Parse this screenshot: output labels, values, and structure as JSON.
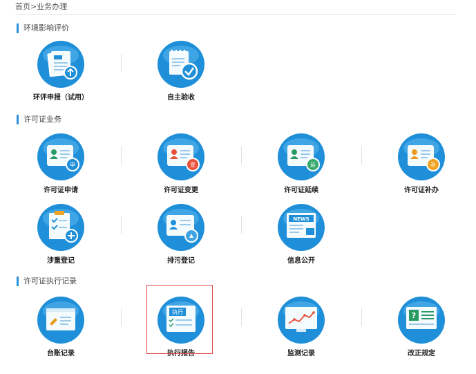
{
  "breadcrumb": "首页>业务办理",
  "accent": "#1e8fd8",
  "sections": [
    {
      "title": "环境影响评价"
    },
    {
      "title": "许可证业务"
    },
    {
      "title": "许可证执行记录"
    }
  ],
  "tiles": [
    {
      "label": "环评申报（试用）",
      "icon": "report-upload-icon"
    },
    {
      "label": "自主验收",
      "icon": "acceptance-check-icon"
    },
    {
      "label": "许可证申请",
      "icon": "license-apply-icon",
      "badge": "申"
    },
    {
      "label": "许可证变更",
      "icon": "license-change-icon",
      "badge": "变"
    },
    {
      "label": "许可证延续",
      "icon": "license-extend-icon",
      "badge": "延"
    },
    {
      "label": "许可证补办",
      "icon": "license-reissue-icon",
      "badge": "补"
    },
    {
      "label": "涉重登记",
      "icon": "heavy-metal-register-icon"
    },
    {
      "label": "排污登记",
      "icon": "discharge-register-icon"
    },
    {
      "label": "信息公开",
      "icon": "info-disclosure-icon",
      "news": "NEWS"
    },
    {
      "label": "台账记录",
      "icon": "ledger-icon"
    },
    {
      "label": "执行报告",
      "icon": "execution-report-icon",
      "tag": "执行",
      "selected": true
    },
    {
      "label": "监测记录",
      "icon": "monitoring-icon"
    },
    {
      "label": "改正规定",
      "icon": "correction-icon"
    }
  ]
}
